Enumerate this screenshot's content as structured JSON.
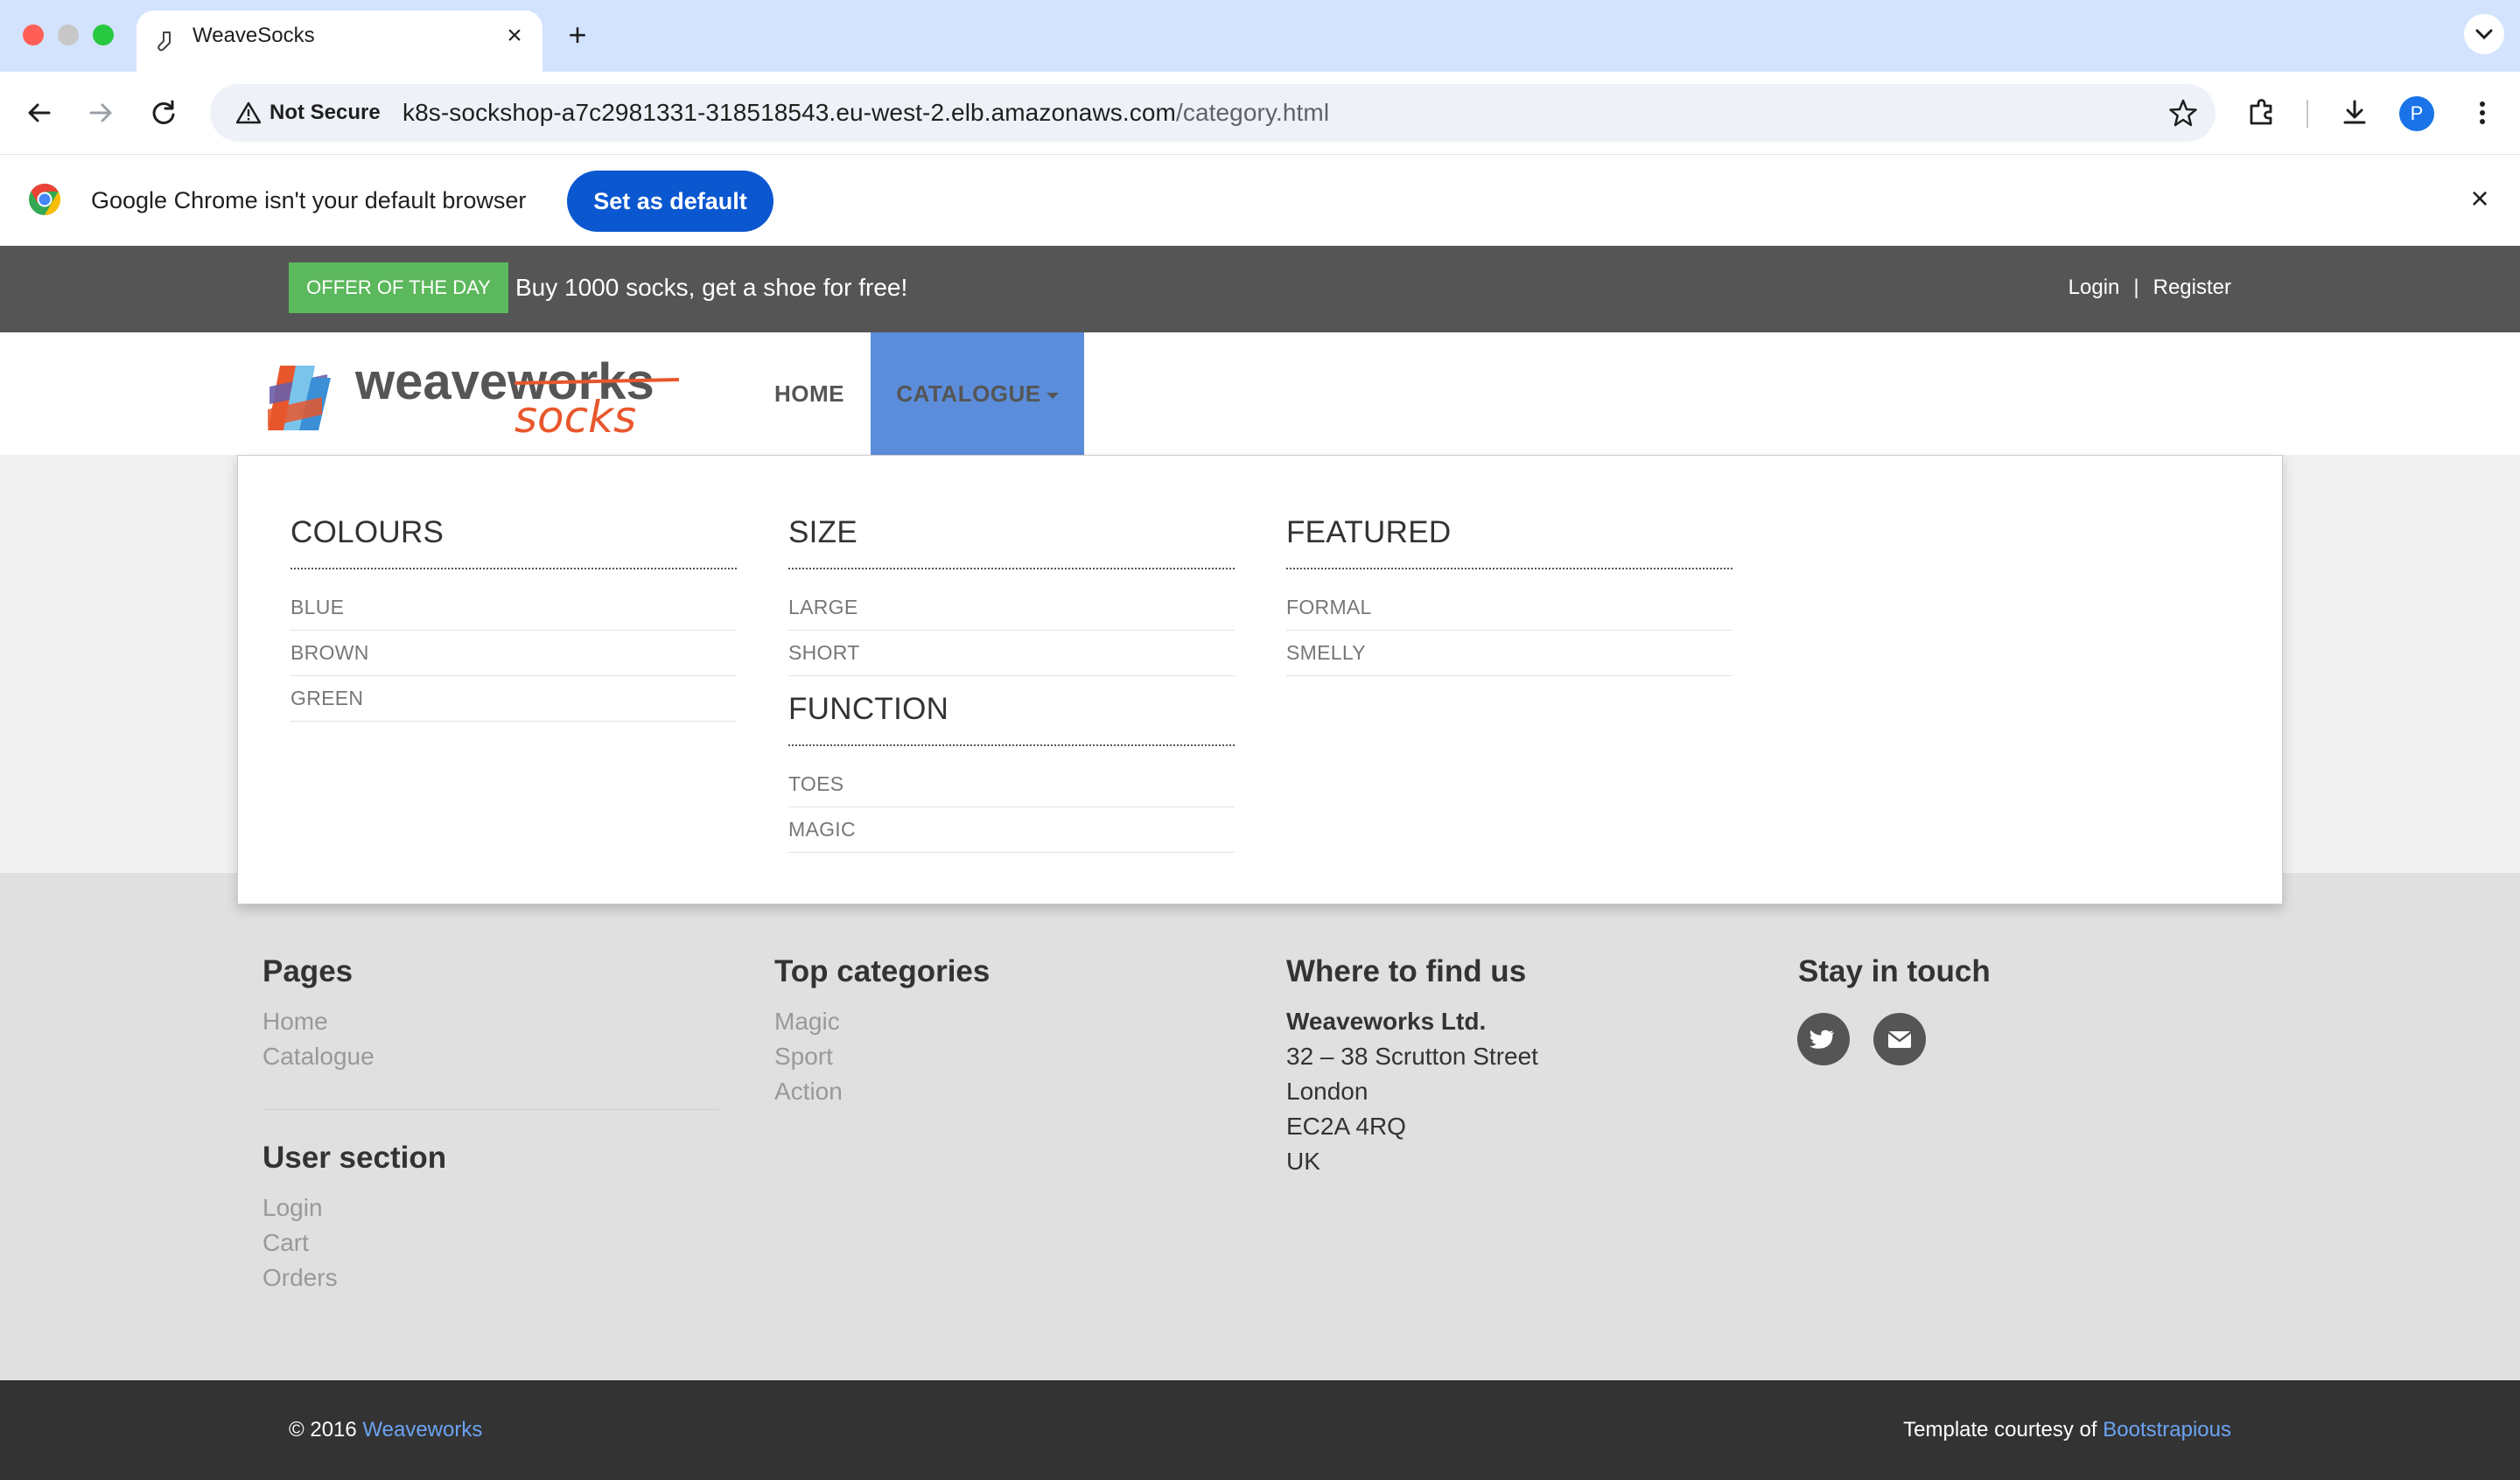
{
  "browser": {
    "tab_title": "WeaveSocks",
    "not_secure_label": "Not Secure",
    "url_host": "k8s-sockshop-a7c2981331-318518543.eu-west-2.elb.amazonaws.com",
    "url_path": "/category.html",
    "profile_initial": "P",
    "infobar_text": "Google Chrome isn't your default browser",
    "set_default_label": "Set as default"
  },
  "topbar": {
    "offer_badge": "OFFER OF THE DAY",
    "offer_text": "Buy 1000 socks, get a shoe for free!",
    "login_label": "Login",
    "separator": "|",
    "register_label": "Register"
  },
  "navbar": {
    "home_label": "HOME",
    "catalogue_label": "CATALOGUE"
  },
  "mega_menu": {
    "colours": {
      "heading": "COLOURS",
      "items": [
        "BLUE",
        "BROWN",
        "GREEN"
      ]
    },
    "size": {
      "heading": "SIZE",
      "items": [
        "LARGE",
        "SHORT"
      ]
    },
    "function": {
      "heading": "FUNCTION",
      "items": [
        "TOES",
        "MAGIC"
      ]
    },
    "featured": {
      "heading": "FEATURED",
      "items": [
        "FORMAL",
        "SMELLY"
      ]
    }
  },
  "footer": {
    "pages": {
      "heading": "Pages",
      "links": [
        "Home",
        "Catalogue"
      ]
    },
    "user_section": {
      "heading": "User section",
      "links": [
        "Login",
        "Cart",
        "Orders"
      ]
    },
    "top_categories": {
      "heading": "Top categories",
      "links": [
        "Magic",
        "Sport",
        "Action"
      ]
    },
    "where": {
      "heading": "Where to find us",
      "company": "Weaveworks Ltd.",
      "lines": [
        "32 – 38 Scrutton Street",
        "London",
        "EC2A 4RQ",
        "UK"
      ]
    },
    "stay": {
      "heading": "Stay in touch"
    }
  },
  "copyright": {
    "prefix": "© 2016 ",
    "brand": "Weaveworks",
    "template_prefix": "Template courtesy of ",
    "template_link": "Bootstrapious"
  },
  "colors": {
    "offer_green": "#5cb85c",
    "nav_active_blue": "#5b8ddb",
    "topbar_gray": "#555555",
    "chrome_button_blue": "#0b57d0",
    "link_blue": "#6ba3f2"
  },
  "icons": [
    "sock-favicon-icon",
    "warning-icon",
    "star-icon",
    "extensions-icon",
    "download-icon",
    "kebab-menu-icon",
    "chrome-logo-icon",
    "twitter-icon",
    "email-icon"
  ]
}
